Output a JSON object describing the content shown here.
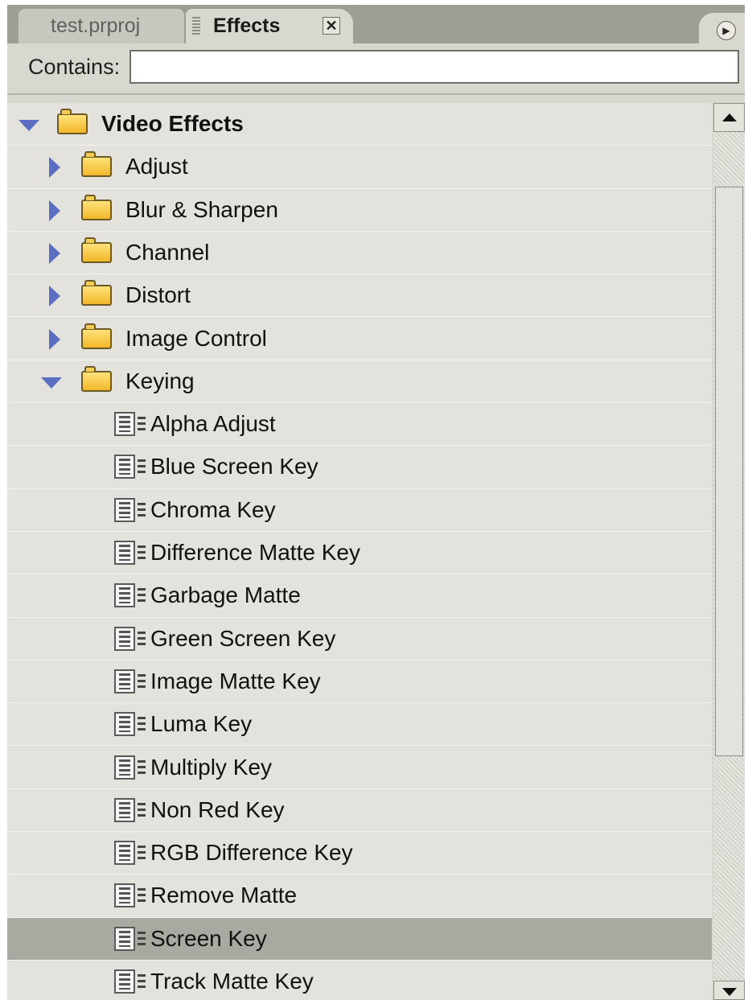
{
  "tabs": {
    "project_label": "test.prproj",
    "effects_label": "Effects",
    "close_glyph": "✕"
  },
  "panel_menu_glyph": "▶",
  "search": {
    "label": "Contains:",
    "value": ""
  },
  "tree": [
    {
      "label": "Video Effects",
      "kind": "folder",
      "state": "expanded",
      "level": 0
    },
    {
      "label": "Adjust",
      "kind": "folder",
      "state": "collapsed",
      "level": 1
    },
    {
      "label": "Blur & Sharpen",
      "kind": "folder",
      "state": "collapsed",
      "level": 1
    },
    {
      "label": "Channel",
      "kind": "folder",
      "state": "collapsed",
      "level": 1
    },
    {
      "label": "Distort",
      "kind": "folder",
      "state": "collapsed",
      "level": 1
    },
    {
      "label": "Image Control",
      "kind": "folder",
      "state": "collapsed",
      "level": 1
    },
    {
      "label": "Keying",
      "kind": "folder",
      "state": "expanded",
      "level": 1
    },
    {
      "label": "Alpha Adjust",
      "kind": "effect",
      "level": 2
    },
    {
      "label": "Blue Screen Key",
      "kind": "effect",
      "level": 2
    },
    {
      "label": "Chroma Key",
      "kind": "effect",
      "level": 2
    },
    {
      "label": "Difference Matte Key",
      "kind": "effect",
      "level": 2
    },
    {
      "label": "Garbage Matte",
      "kind": "effect",
      "level": 2
    },
    {
      "label": "Green Screen Key",
      "kind": "effect",
      "level": 2
    },
    {
      "label": "Image Matte Key",
      "kind": "effect",
      "level": 2
    },
    {
      "label": "Luma Key",
      "kind": "effect",
      "level": 2
    },
    {
      "label": "Multiply Key",
      "kind": "effect",
      "level": 2
    },
    {
      "label": "Non Red Key",
      "kind": "effect",
      "level": 2
    },
    {
      "label": "RGB Difference Key",
      "kind": "effect",
      "level": 2
    },
    {
      "label": "Remove Matte",
      "kind": "effect",
      "level": 2
    },
    {
      "label": "Screen Key",
      "kind": "effect",
      "level": 2,
      "selected": true
    },
    {
      "label": "Track Matte Key",
      "kind": "effect",
      "level": 2
    }
  ],
  "colors": {
    "selected_row": "#a9a8a1",
    "expander": "#5b6ec2",
    "folder": "#f2b72a"
  }
}
